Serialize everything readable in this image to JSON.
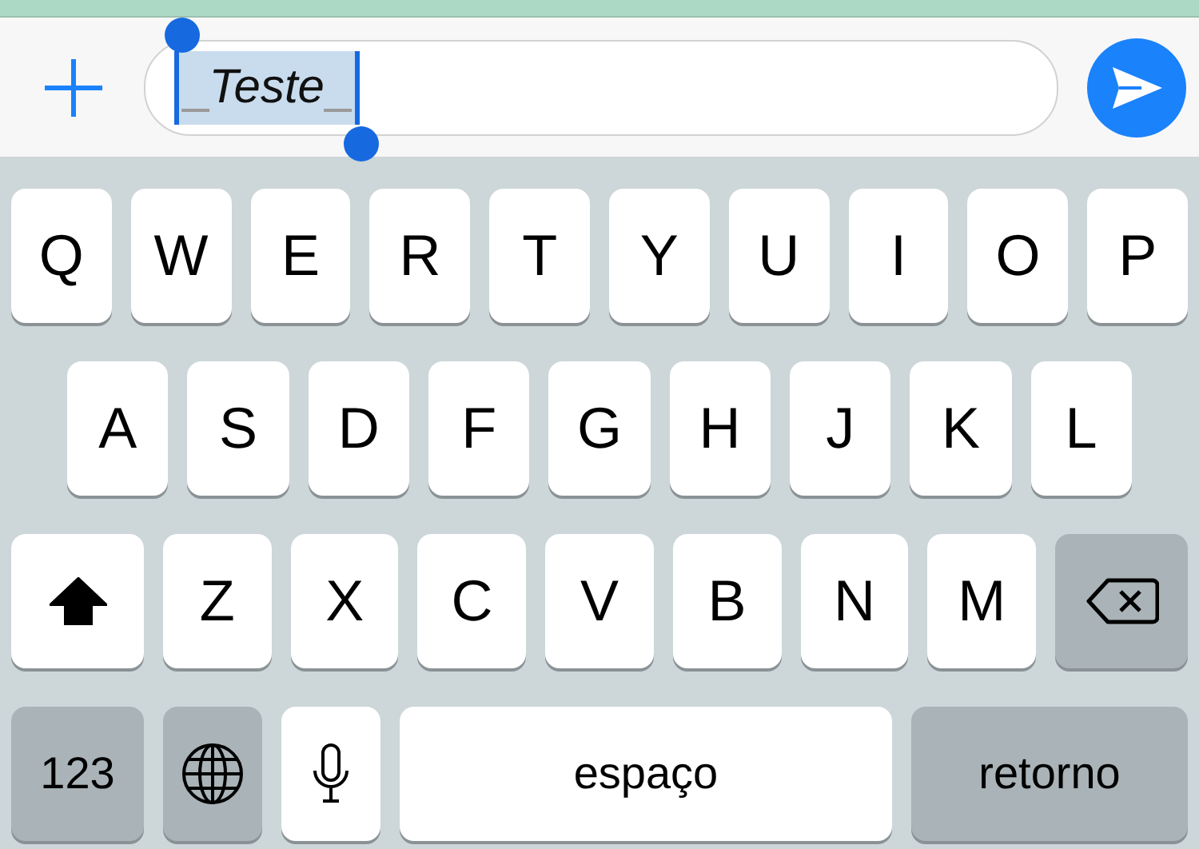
{
  "composer": {
    "open_marker": "_",
    "message": "Teste",
    "close_marker": "_",
    "selected": true
  },
  "keyboard": {
    "rows": [
      {
        "keys": [
          {
            "kind": "letter",
            "label": "Q"
          },
          {
            "kind": "letter",
            "label": "W"
          },
          {
            "kind": "letter",
            "label": "E"
          },
          {
            "kind": "letter",
            "label": "R"
          },
          {
            "kind": "letter",
            "label": "T"
          },
          {
            "kind": "letter",
            "label": "Y"
          },
          {
            "kind": "letter",
            "label": "U"
          },
          {
            "kind": "letter",
            "label": "I"
          },
          {
            "kind": "letter",
            "label": "O"
          },
          {
            "kind": "letter",
            "label": "P"
          }
        ]
      },
      {
        "keys": [
          {
            "kind": "letter",
            "label": "A"
          },
          {
            "kind": "letter",
            "label": "S"
          },
          {
            "kind": "letter",
            "label": "D"
          },
          {
            "kind": "letter",
            "label": "F"
          },
          {
            "kind": "letter",
            "label": "G"
          },
          {
            "kind": "letter",
            "label": "H"
          },
          {
            "kind": "letter",
            "label": "J"
          },
          {
            "kind": "letter",
            "label": "K"
          },
          {
            "kind": "letter",
            "label": "L"
          }
        ]
      },
      {
        "keys": [
          {
            "kind": "shift",
            "on": true
          },
          {
            "kind": "letter",
            "label": "Z"
          },
          {
            "kind": "letter",
            "label": "X"
          },
          {
            "kind": "letter",
            "label": "C"
          },
          {
            "kind": "letter",
            "label": "V"
          },
          {
            "kind": "letter",
            "label": "B"
          },
          {
            "kind": "letter",
            "label": "N"
          },
          {
            "kind": "letter",
            "label": "M"
          },
          {
            "kind": "delete"
          }
        ]
      },
      {
        "keys": [
          {
            "kind": "numbers",
            "label": "123"
          },
          {
            "kind": "globe"
          },
          {
            "kind": "mic"
          },
          {
            "kind": "space",
            "label": "espaço"
          },
          {
            "kind": "return",
            "label": "retorno"
          }
        ]
      }
    ]
  }
}
